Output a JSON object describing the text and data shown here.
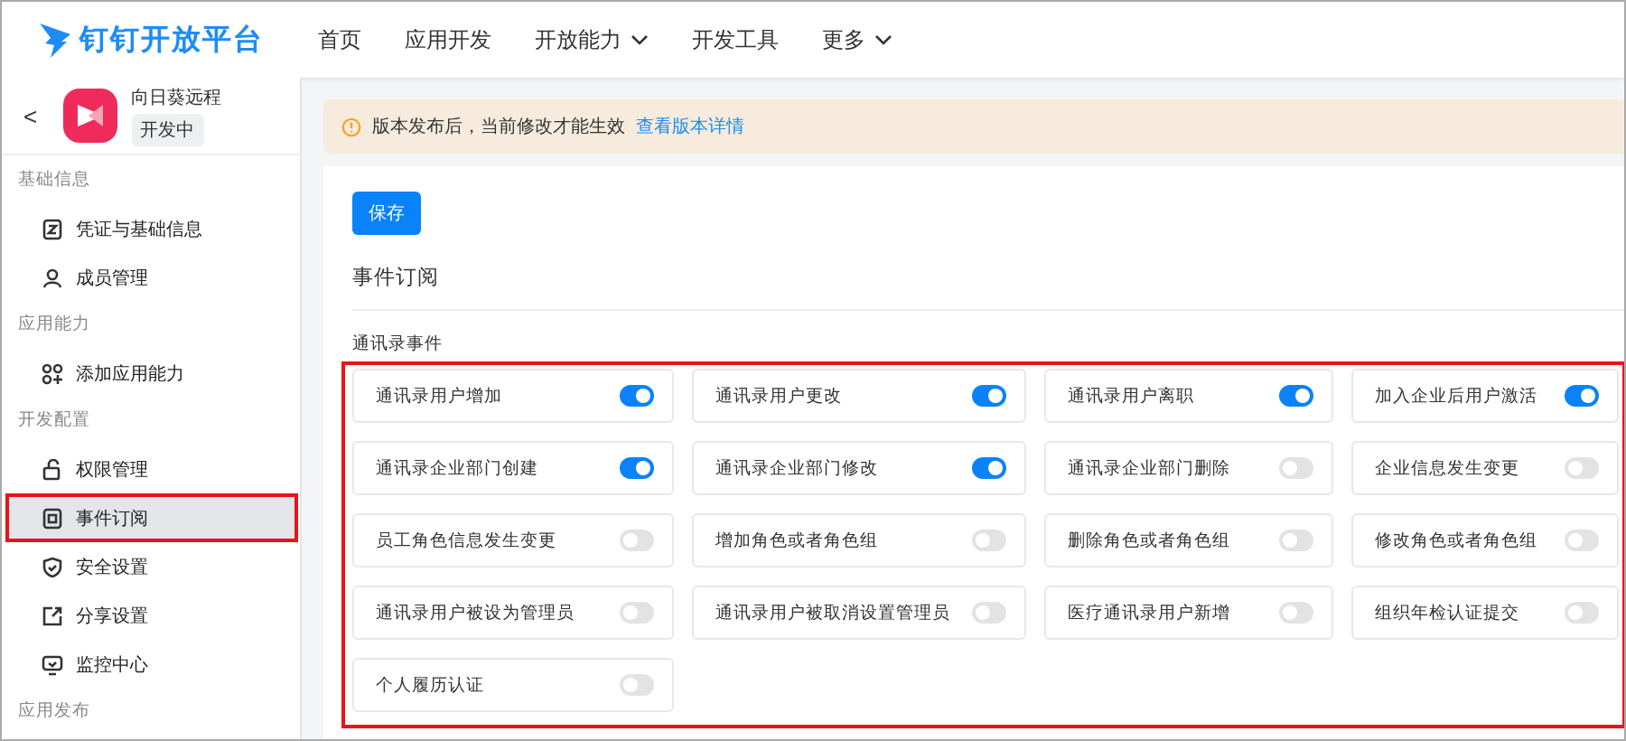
{
  "header": {
    "logo": "钉钉开放平台",
    "nav": [
      {
        "label": "首页",
        "dropdown": false
      },
      {
        "label": "应用开发",
        "dropdown": false
      },
      {
        "label": "开放能力",
        "dropdown": true
      },
      {
        "label": "开发工具",
        "dropdown": false
      },
      {
        "label": "更多",
        "dropdown": true
      }
    ]
  },
  "app": {
    "back": "<",
    "name": "向日葵远程",
    "status": "开发中"
  },
  "sidebar": [
    {
      "kind": "group",
      "label": "基础信息"
    },
    {
      "kind": "item",
      "label": "凭证与基础信息",
      "selected": false,
      "highlighted": false
    },
    {
      "kind": "item",
      "label": "成员管理",
      "selected": false,
      "highlighted": false
    },
    {
      "kind": "group",
      "label": "应用能力"
    },
    {
      "kind": "item",
      "label": "添加应用能力",
      "selected": false,
      "highlighted": false
    },
    {
      "kind": "group",
      "label": "开发配置"
    },
    {
      "kind": "item",
      "label": "权限管理",
      "selected": false,
      "highlighted": false
    },
    {
      "kind": "item",
      "label": "事件订阅",
      "selected": true,
      "highlighted": true
    },
    {
      "kind": "item",
      "label": "安全设置",
      "selected": false,
      "highlighted": false
    },
    {
      "kind": "item",
      "label": "分享设置",
      "selected": false,
      "highlighted": false
    },
    {
      "kind": "item",
      "label": "监控中心",
      "selected": false,
      "highlighted": false
    },
    {
      "kind": "group",
      "label": "应用发布"
    }
  ],
  "notice": {
    "text": "版本发布后，当前修改才能生效",
    "link": "查看版本详情"
  },
  "save_button": "保存",
  "section_title": "事件订阅",
  "events": {
    "title": "通讯录事件",
    "highlighted": true,
    "items": [
      {
        "label": "通讯录用户增加",
        "on": true
      },
      {
        "label": "通讯录用户更改",
        "on": true
      },
      {
        "label": "通讯录用户离职",
        "on": true
      },
      {
        "label": "加入企业后用户激活",
        "on": true
      },
      {
        "label": "通讯录企业部门创建",
        "on": true
      },
      {
        "label": "通讯录企业部门修改",
        "on": true
      },
      {
        "label": "通讯录企业部门删除",
        "on": false
      },
      {
        "label": "企业信息发生变更",
        "on": false
      },
      {
        "label": "员工角色信息发生变更",
        "on": false
      },
      {
        "label": "增加角色或者角色组",
        "on": false
      },
      {
        "label": "删除角色或者角色组",
        "on": false
      },
      {
        "label": "修改角色或者角色组",
        "on": false
      },
      {
        "label": "通讯录用户被设为管理员",
        "on": false
      },
      {
        "label": "通讯录用户被取消设置管理员",
        "on": false
      },
      {
        "label": "医疗通讯录用户新增",
        "on": false
      },
      {
        "label": "组织年检认证提交",
        "on": false
      },
      {
        "label": "个人履历认证",
        "on": false
      }
    ]
  }
}
